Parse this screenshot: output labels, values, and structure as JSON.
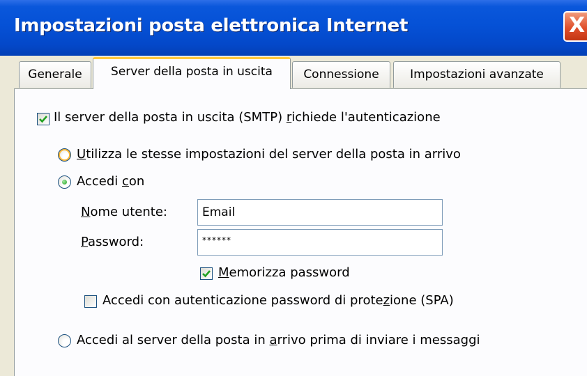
{
  "window": {
    "title": "Impostazioni posta elettronica Internet",
    "close_glyph": "X"
  },
  "tabs": [
    {
      "label": "Generale",
      "active": false
    },
    {
      "label": "Server della posta in uscita",
      "active": true
    },
    {
      "label": "Connessione",
      "active": false
    },
    {
      "label": "Impostazioni avanzate",
      "active": false
    }
  ],
  "smtp_auth": {
    "checked": true,
    "label_before": "Il server della posta in uscita (SMTP) ",
    "label_underlined": "r",
    "label_after": "ichiede l'autenticazione"
  },
  "options": {
    "same_settings": {
      "selected": false,
      "label_underlined": "U",
      "label_after": "tilizza le stesse impostazioni del server della posta in arrivo"
    },
    "log_on_with": {
      "selected": true,
      "label_before": "Accedi ",
      "label_underlined": "c",
      "label_after": "on"
    },
    "log_on_before_send": {
      "selected": false,
      "label_before": "Accedi al server della posta in ",
      "label_underlined": "a",
      "label_after": "rrivo prima di inviare i messaggi"
    }
  },
  "credentials": {
    "username_label_underlined": "N",
    "username_label_after": "ome utente:",
    "username_value": "Email",
    "password_label_underlined": "P",
    "password_label_after": "assword:",
    "password_value": "******"
  },
  "remember_password": {
    "checked": true,
    "label_underlined": "M",
    "label_after": "emorizza password"
  },
  "spa": {
    "checked": false,
    "label_before": "Accedi con autenticazione password di prote",
    "label_underlined": "z",
    "label_after": "ione (SPA)"
  },
  "colors": {
    "titlebar": "#0551d6",
    "dialog_bg": "#ece9d8",
    "active_tab_accent": "#ffc83c",
    "check_green": "#21a121",
    "close_red": "#e0502c"
  }
}
